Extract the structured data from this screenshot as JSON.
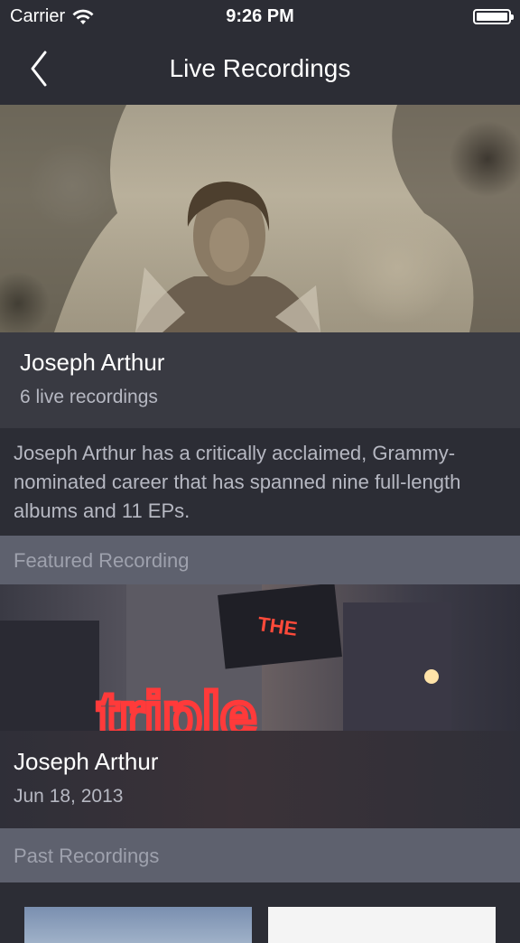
{
  "status_bar": {
    "carrier": "Carrier",
    "time": "9:26 PM"
  },
  "nav": {
    "title": "Live Recordings"
  },
  "artist": {
    "name": "Joseph Arthur",
    "recording_count": "6 live recordings",
    "bio": "Joseph Arthur has a critically acclaimed, Grammy-nominated career that has spanned nine full-length albums and 11 EPs."
  },
  "featured": {
    "header": "Featured Recording",
    "title": "Joseph Arthur",
    "date": "Jun 18, 2013",
    "sign_line_1": "THE",
    "sign_line_2": "triple"
  },
  "past": {
    "header": "Past Recordings"
  },
  "colors": {
    "background": "#2c2d35",
    "section_header": "#5e616e",
    "secondary_text": "#b6b8c2",
    "neon": "#ff3a3a"
  },
  "icons": {
    "back": "chevron-left-icon",
    "wifi": "wifi-icon",
    "battery": "battery-icon"
  }
}
